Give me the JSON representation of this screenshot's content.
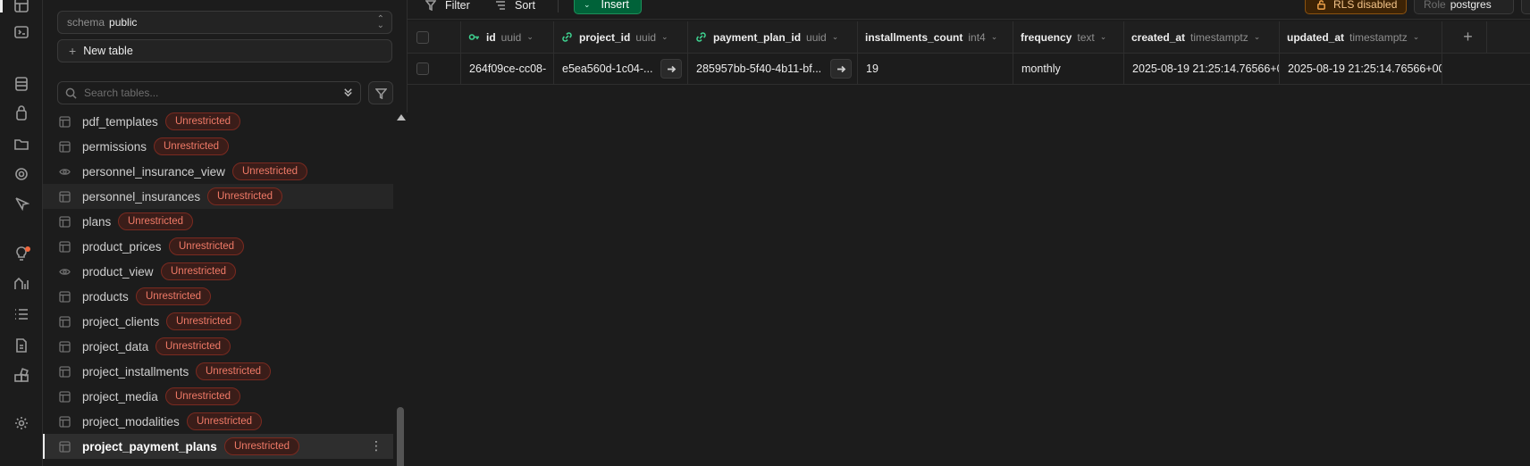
{
  "rail": {
    "icons": [
      "table-editor-icon",
      "sql-editor-icon",
      "database-icon",
      "auth-icon",
      "storage-icon",
      "edge-functions-icon",
      "realtime-icon",
      "advisors-icon",
      "reports-icon",
      "logs-icon",
      "api-docs-icon",
      "integrations-icon",
      "settings-icon"
    ]
  },
  "sidebar": {
    "schema_label": "schema",
    "schema_value": "public",
    "new_table_label": "New table",
    "search_placeholder": "Search tables...",
    "badge_text": "Unrestricted",
    "tables": [
      {
        "name": "pdf_templates",
        "kind": "table"
      },
      {
        "name": "permissions",
        "kind": "table"
      },
      {
        "name": "personnel_insurance_view",
        "kind": "view"
      },
      {
        "name": "personnel_insurances",
        "kind": "table"
      },
      {
        "name": "plans",
        "kind": "table"
      },
      {
        "name": "product_prices",
        "kind": "table"
      },
      {
        "name": "product_view",
        "kind": "view"
      },
      {
        "name": "products",
        "kind": "table"
      },
      {
        "name": "project_clients",
        "kind": "table"
      },
      {
        "name": "project_data",
        "kind": "table"
      },
      {
        "name": "project_installments",
        "kind": "table"
      },
      {
        "name": "project_media",
        "kind": "table"
      },
      {
        "name": "project_modalities",
        "kind": "table"
      },
      {
        "name": "project_payment_plans",
        "kind": "table",
        "selected": true
      }
    ]
  },
  "toolbar": {
    "filter_label": "Filter",
    "sort_label": "Sort",
    "insert_label": "Insert",
    "rls_label": "RLS disabled",
    "role_label": "Role",
    "role_value": "postgres"
  },
  "grid": {
    "columns": [
      {
        "name": "id",
        "type": "uuid",
        "icon": "key-icon"
      },
      {
        "name": "project_id",
        "type": "uuid",
        "icon": "link-icon"
      },
      {
        "name": "payment_plan_id",
        "type": "uuid",
        "icon": "link-icon"
      },
      {
        "name": "installments_count",
        "type": "int4",
        "icon": ""
      },
      {
        "name": "frequency",
        "type": "text",
        "icon": ""
      },
      {
        "name": "created_at",
        "type": "timestamptz",
        "icon": ""
      },
      {
        "name": "updated_at",
        "type": "timestamptz",
        "icon": ""
      }
    ],
    "rows": [
      [
        "264f09ce-cc08-",
        "e5ea560d-1c04-...",
        "285957bb-5f40-4b11-bf...",
        "19",
        "monthly",
        "2025-08-19 21:25:14.76566+0",
        "2025-08-19 21:25:14.76566+00"
      ]
    ],
    "add_column_label": "+"
  },
  "colors": {
    "accent_green": "#006239",
    "badge_red": "#f07a67",
    "rls_amber": "#f0a34a"
  }
}
